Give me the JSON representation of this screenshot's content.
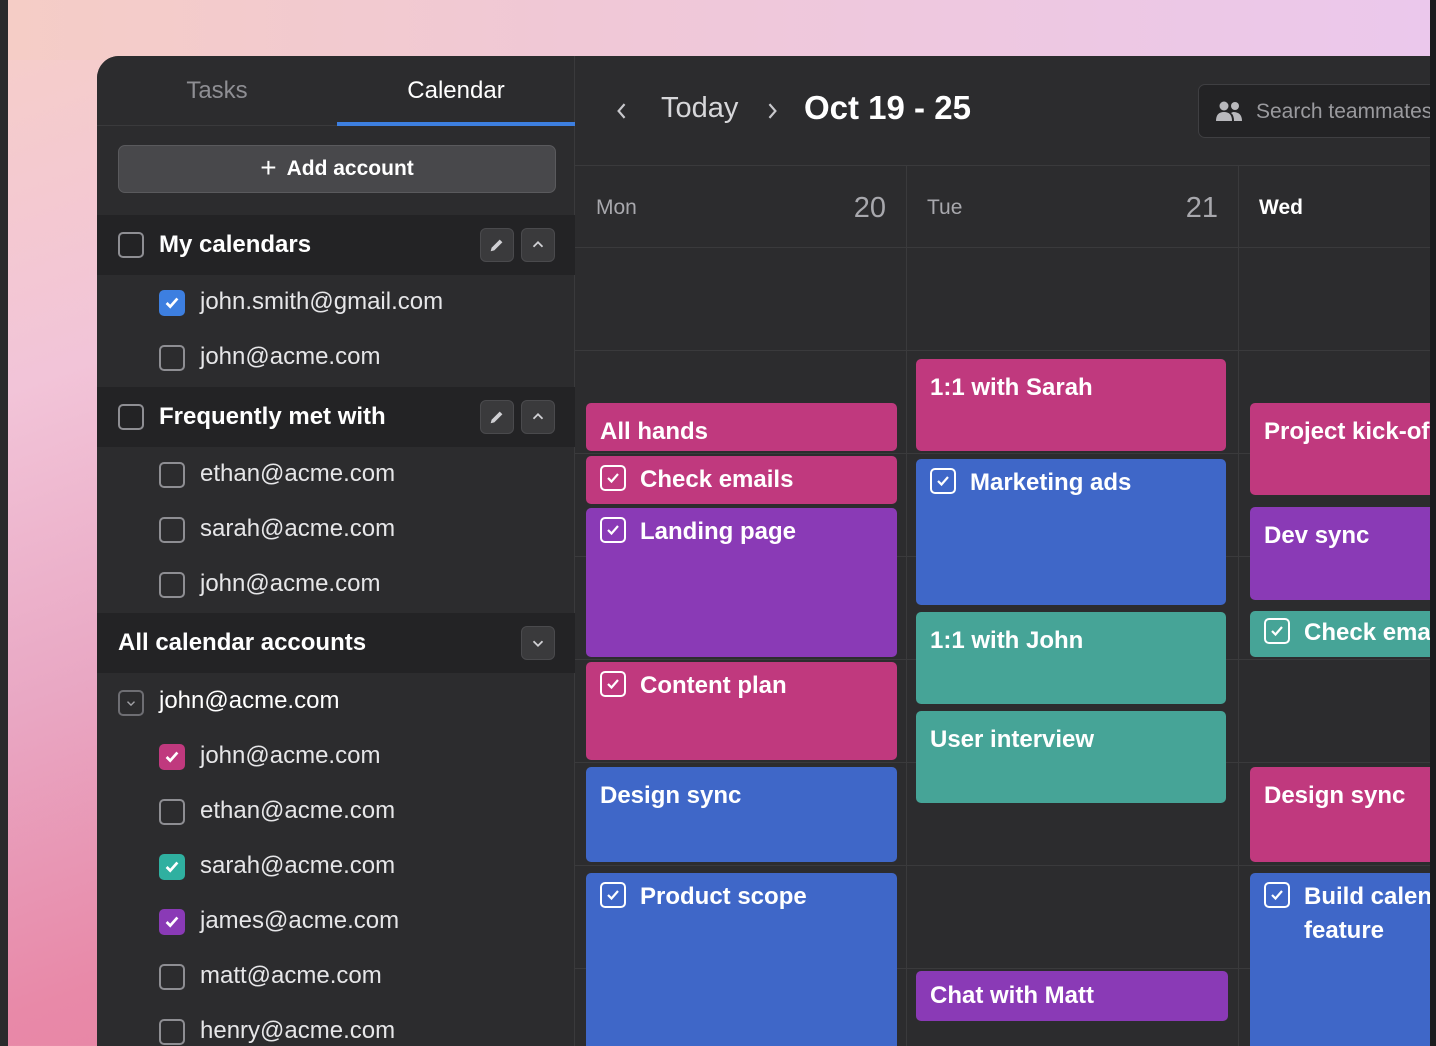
{
  "colors": {
    "pink": "#c0397e",
    "purple": "#8a3ab6",
    "blue": "#3f67c8",
    "teal": "#46a497",
    "accent": "#3d7fe0"
  },
  "tabs": {
    "tasks": "Tasks",
    "calendar": "Calendar"
  },
  "add_account": {
    "icon": "plus-icon",
    "label": "Add account"
  },
  "my_calendars": {
    "title": "My calendars",
    "items": [
      {
        "label": "john.smith@gmail.com",
        "checked": true,
        "color": "#3d7fe0"
      },
      {
        "label": "john@acme.com",
        "checked": false
      }
    ]
  },
  "frequently_met": {
    "title": "Frequently met with",
    "items": [
      {
        "label": "ethan@acme.com",
        "checked": false
      },
      {
        "label": "sarah@acme.com",
        "checked": false
      },
      {
        "label": "john@acme.com",
        "checked": false
      }
    ]
  },
  "all_accounts": {
    "title": "All calendar accounts",
    "account": "john@acme.com",
    "items": [
      {
        "label": "john@acme.com",
        "checked": true,
        "color": "#c0397e"
      },
      {
        "label": "ethan@acme.com",
        "checked": false
      },
      {
        "label": "sarah@acme.com",
        "checked": true,
        "color": "#2fb0a0"
      },
      {
        "label": "james@acme.com",
        "checked": true,
        "color": "#8a3ab6"
      },
      {
        "label": "matt@acme.com",
        "checked": false
      },
      {
        "label": "henry@acme.com",
        "checked": false
      }
    ]
  },
  "header": {
    "today": "Today",
    "range": "Oct 19 - 25",
    "search_placeholder": "Search teammates"
  },
  "days": [
    {
      "name": "Mon",
      "num": "20"
    },
    {
      "name": "Tue",
      "num": "21"
    },
    {
      "name": "Wed",
      "num": ""
    }
  ],
  "events": {
    "mon": [
      "All hands",
      "Check emails",
      "Landing page",
      "Content plan",
      "Design sync",
      "Product scope"
    ],
    "tue": [
      "1:1 with Sarah",
      "Marketing ads",
      "1:1 with John",
      "User interview",
      "Chat with Matt"
    ],
    "wed": [
      "Project kick-off",
      "Dev sync",
      "Check emails",
      "Design sync",
      "Build calendar",
      "feature"
    ]
  }
}
